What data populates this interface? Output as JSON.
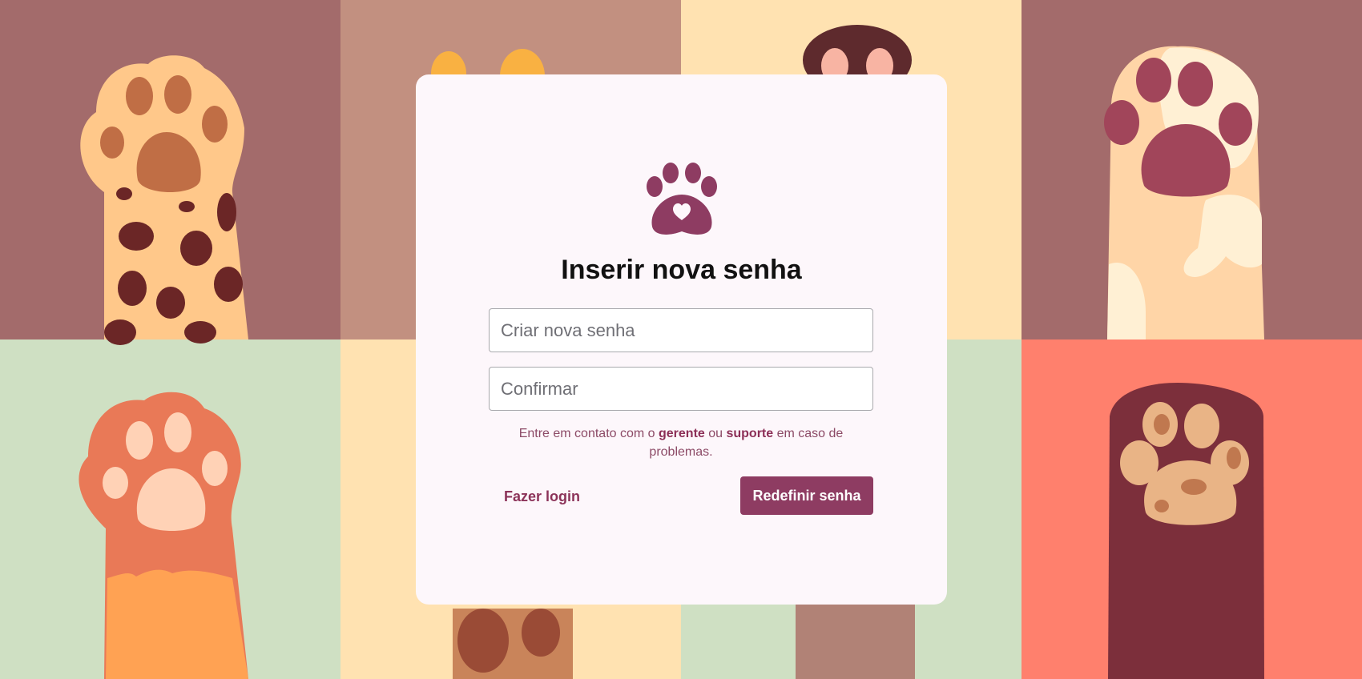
{
  "form": {
    "title": "Inserir nova senha",
    "new_password_placeholder": "Criar nova senha",
    "confirm_placeholder": "Confirmar",
    "help_prefix": "Entre em contato com o ",
    "help_manager": "gerente",
    "help_or": " ou ",
    "help_support": "suporte",
    "help_suffix": " em caso de problemas.",
    "login_link": "Fazer login",
    "reset_button": "Redefinir senha"
  },
  "icons": {
    "logo": "paw-heart-icon"
  },
  "colors": {
    "accent": "#8e3c62",
    "card_bg": "#fdf7fb"
  }
}
